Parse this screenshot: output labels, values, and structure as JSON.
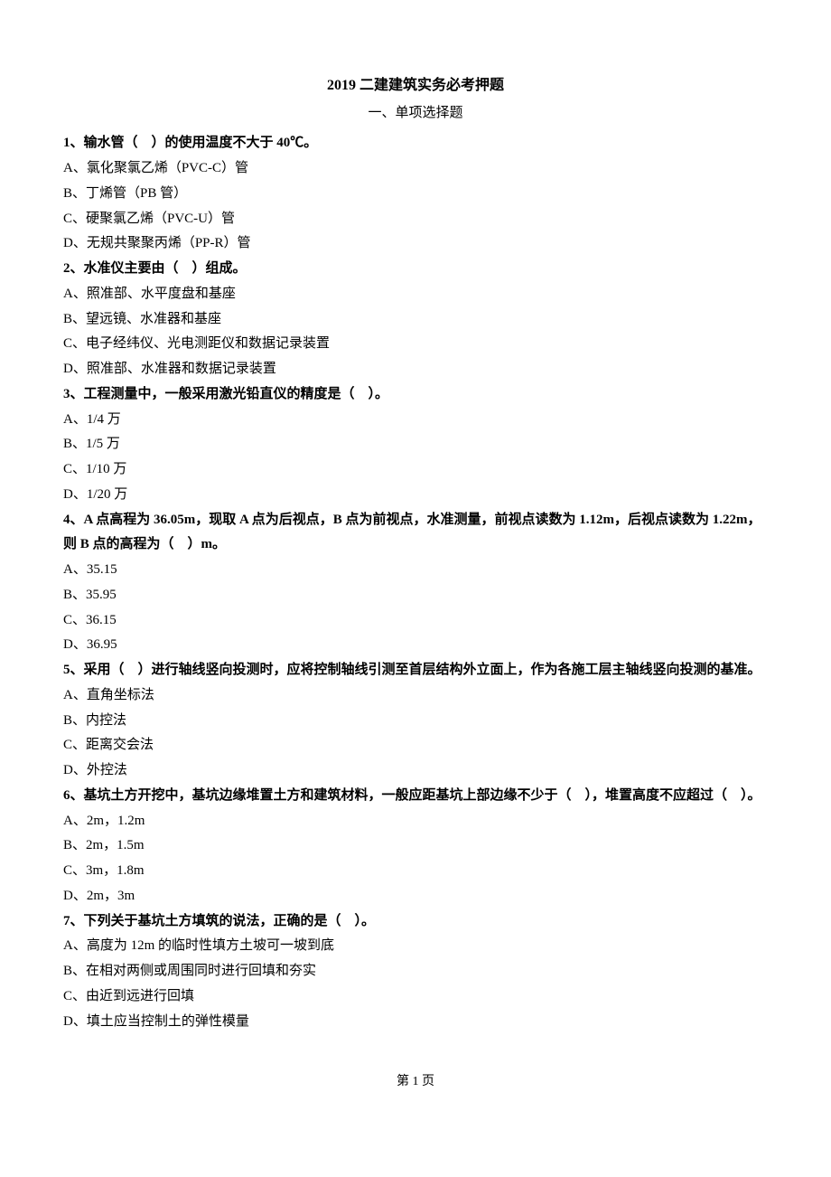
{
  "title": "2019 二建建筑实务必考押题",
  "section_heading": "一、单项选择题",
  "questions": [
    {
      "stem": "1、输水管（　）的使用温度不大于 40℃。",
      "options": [
        "A、氯化聚氯乙烯（PVC-C）管",
        "B、丁烯管（PB 管）",
        "C、硬聚氯乙烯（PVC-U）管",
        "D、无规共聚聚丙烯（PP-R）管"
      ]
    },
    {
      "stem": "2、水准仪主要由（　）组成。",
      "options": [
        "A、照准部、水平度盘和基座",
        "B、望远镜、水准器和基座",
        "C、电子经纬仪、光电测距仪和数据记录装置",
        "D、照准部、水准器和数据记录装置"
      ]
    },
    {
      "stem": "3、工程测量中，一般采用激光铅直仪的精度是（　）。",
      "options": [
        "A、1/4 万",
        "B、1/5 万",
        "C、1/10 万",
        "D、1/20 万"
      ]
    },
    {
      "stem": "4、A 点高程为 36.05m，现取 A 点为后视点，B 点为前视点，水准测量，前视点读数为 1.12m，后视点读数为 1.22m，则 B 点的高程为（　）m。",
      "options": [
        "A、35.15",
        "B、35.95",
        "C、36.15",
        "D、36.95"
      ]
    },
    {
      "stem": "5、采用（　）进行轴线竖向投测时，应将控制轴线引测至首层结构外立面上，作为各施工层主轴线竖向投测的基准。",
      "options": [
        "A、直角坐标法",
        "B、内控法",
        "C、距离交会法",
        "D、外控法"
      ]
    },
    {
      "stem": "6、基坑土方开挖中，基坑边缘堆置土方和建筑材料，一般应距基坑上部边缘不少于（　），堆置高度不应超过（　）。",
      "options": [
        "A、2m，1.2m",
        "B、2m，1.5m",
        "C、3m，1.8m",
        "D、2m，3m"
      ]
    },
    {
      "stem": "7、下列关于基坑土方填筑的说法，正确的是（　）。",
      "options": [
        "A、高度为 12m 的临时性填方土坡可一坡到底",
        "B、在相对两侧或周围同时进行回填和夯实",
        "C、由近到远进行回填",
        "D、填土应当控制土的弹性模量"
      ]
    }
  ],
  "footer": "第 1 页"
}
